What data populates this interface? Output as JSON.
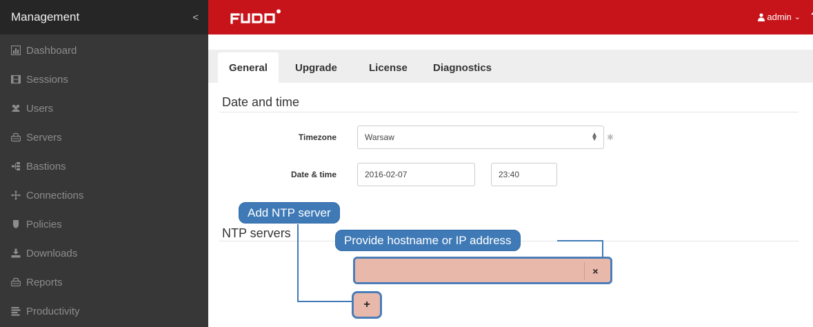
{
  "sidebar": {
    "title": "Management",
    "collapse_glyph": "<",
    "items": [
      {
        "label": "Dashboard",
        "icon": "dashboard-icon"
      },
      {
        "label": "Sessions",
        "icon": "sessions-icon"
      },
      {
        "label": "Users",
        "icon": "users-icon"
      },
      {
        "label": "Servers",
        "icon": "servers-icon"
      },
      {
        "label": "Bastions",
        "icon": "bastions-icon"
      },
      {
        "label": "Connections",
        "icon": "connections-icon"
      },
      {
        "label": "Policies",
        "icon": "policies-icon"
      },
      {
        "label": "Downloads",
        "icon": "downloads-icon"
      },
      {
        "label": "Reports",
        "icon": "reports-icon"
      },
      {
        "label": "Productivity",
        "icon": "productivity-icon"
      }
    ]
  },
  "header": {
    "logo_text": "FUDO",
    "user": "admin",
    "user_caret": "⌄",
    "help": "?",
    "accent_color": "#c7141b"
  },
  "tabs": [
    "General",
    "Upgrade",
    "License",
    "Diagnostics"
  ],
  "date_time": {
    "section_title": "Date and time",
    "timezone_label": "Timezone",
    "timezone_value": "Warsaw",
    "datetime_label": "Date & time",
    "date_value": "2016-02-07",
    "time_value": "23:40"
  },
  "ntp": {
    "section_title": "NTP servers",
    "input_value": "",
    "clear_glyph": "×",
    "add_glyph": "+"
  },
  "callouts": {
    "add_server": "Add NTP server",
    "hostname": "Provide hostname or IP address"
  }
}
